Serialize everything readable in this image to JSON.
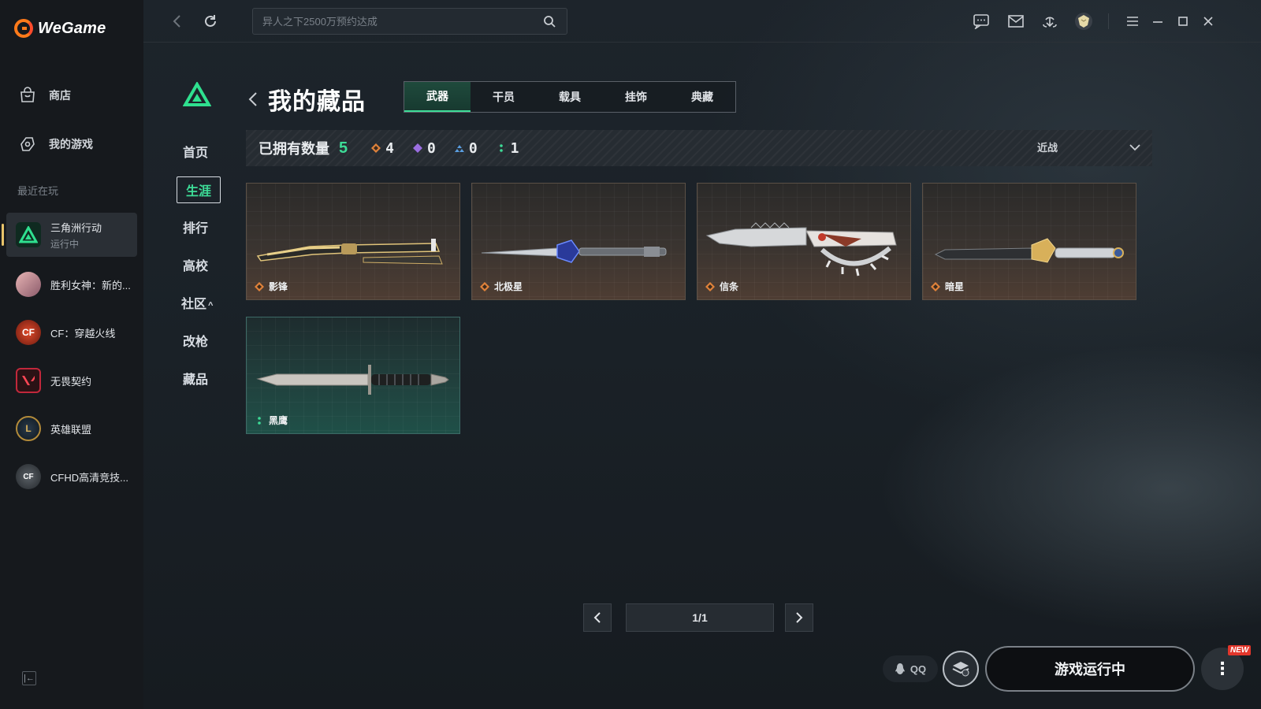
{
  "app": {
    "name": "WeGame"
  },
  "sidebar": {
    "nav": [
      {
        "label": "商店",
        "icon": "store-icon"
      },
      {
        "label": "我的游戏",
        "icon": "my-games-icon"
      }
    ],
    "recent_label": "最近在玩",
    "games": [
      {
        "title": "三角洲行动",
        "status": "运行中",
        "icon": "delta-force-icon",
        "color": "#1fa36a"
      },
      {
        "title": "胜利女神：新的...",
        "status": "",
        "icon": "nikke-icon",
        "color": "#c98d8d"
      },
      {
        "title": "CF：穿越火线",
        "status": "",
        "icon": "crossfire-icon",
        "color": "#b33a2a"
      },
      {
        "title": "无畏契约",
        "status": "",
        "icon": "valorant-icon",
        "color": "#c1283b"
      },
      {
        "title": "英雄联盟",
        "status": "",
        "icon": "league-icon",
        "color": "#b38b3a"
      },
      {
        "title": "CFHD高清竞技...",
        "status": "",
        "icon": "cfhd-icon",
        "color": "#7a8087"
      }
    ]
  },
  "topbar": {
    "search_placeholder": "异人之下2500万预约达成"
  },
  "game_nav": {
    "items": [
      "首页",
      "生涯",
      "排行",
      "高校",
      "社区",
      "改枪",
      "藏品"
    ],
    "active": "生涯",
    "community_caret": "^"
  },
  "page": {
    "title": "我的藏品",
    "tabs": [
      "武器",
      "干员",
      "载具",
      "挂饰",
      "典藏"
    ],
    "active_tab": "武器"
  },
  "summary": {
    "owned_label": "已拥有数量",
    "owned_count": "5",
    "rarities": [
      {
        "icon": "orange-rarity-icon",
        "count": "4",
        "color": "#e0823a"
      },
      {
        "icon": "purple-rarity-icon",
        "count": "0",
        "color": "#9a6ee0"
      },
      {
        "icon": "blue-rarity-icon",
        "count": "0",
        "color": "#5a9ee0"
      },
      {
        "icon": "green-rarity-icon",
        "count": "1",
        "color": "#3ddc97"
      }
    ],
    "filter_label": "近战"
  },
  "items": [
    {
      "name": "影锋",
      "rarity": "orange"
    },
    {
      "name": "北极星",
      "rarity": "orange"
    },
    {
      "name": "信条",
      "rarity": "orange"
    },
    {
      "name": "暗星",
      "rarity": "orange"
    },
    {
      "name": "黑鹰",
      "rarity": "green"
    }
  ],
  "pagination": {
    "display": "1/1"
  },
  "footer": {
    "qq_label": "QQ",
    "play_label": "游戏运行中",
    "new_badge": "NEW"
  },
  "colors": {
    "accent": "#3ddc97",
    "rarity_orange": "#e0823a"
  }
}
